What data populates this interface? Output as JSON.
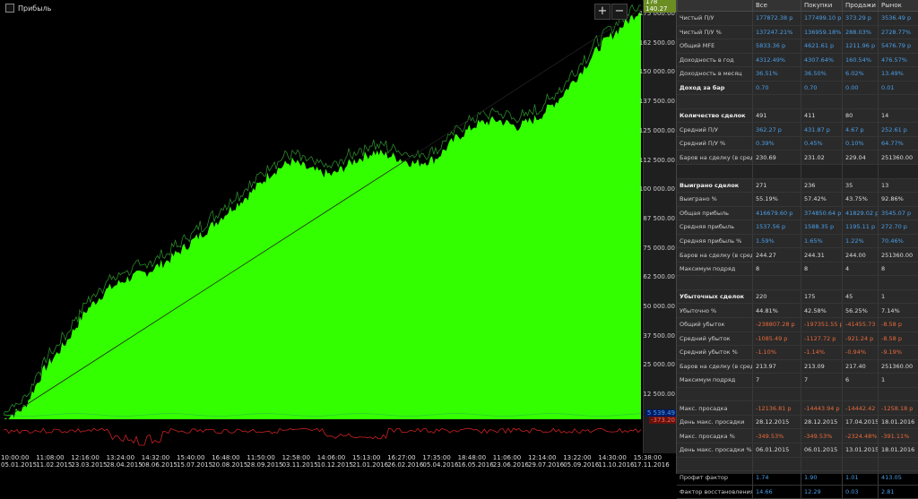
{
  "chart": {
    "title": "Прибыль",
    "zoom_in": "+",
    "zoom_out": "−",
    "y_ticks": [
      "175 000.00",
      "162 500.00",
      "150 000.00",
      "137 500.00",
      "125 000.00",
      "112 500.00",
      "100 000.00",
      "87 500.00",
      "75 000.00",
      "62 500.00",
      "50 000.00",
      "37 500.00",
      "25 000.00",
      "12 500.00"
    ],
    "y_badges": {
      "top": "178 140.27",
      "mid": "5 539.49",
      "bottom": "-373.20"
    },
    "x_ticks": [
      {
        "time": "10:00:00",
        "date": "05.01.2015"
      },
      {
        "time": "11:08:00",
        "date": "11.02.2015"
      },
      {
        "time": "12:16:00",
        "date": "23.03.2015"
      },
      {
        "time": "13:24:00",
        "date": "28.04.2015"
      },
      {
        "time": "14:32:00",
        "date": "08.06.2015"
      },
      {
        "time": "15:40:00",
        "date": "15.07.2015"
      },
      {
        "time": "16:48:00",
        "date": "20.08.2015"
      },
      {
        "time": "11:50:00",
        "date": "28.09.2015"
      },
      {
        "time": "12:58:00",
        "date": "03.11.2015"
      },
      {
        "time": "14:06:00",
        "date": "10.12.2015"
      },
      {
        "time": "15:13:00",
        "date": "21.01.2016"
      },
      {
        "time": "16:27:00",
        "date": "26.02.2016"
      },
      {
        "time": "17:35:00",
        "date": "05.04.2016"
      },
      {
        "time": "18:48:00",
        "date": "16.05.2016"
      },
      {
        "time": "11:06:00",
        "date": "23.06.2016"
      },
      {
        "time": "12:14:00",
        "date": "29.07.2016"
      },
      {
        "time": "13:22:00",
        "date": "05.09.2016"
      },
      {
        "time": "14:30:00",
        "date": "11.10.2016"
      },
      {
        "time": "15:38:00",
        "date": "17.11.2016"
      }
    ],
    "colors": {
      "equity": "#33ff00",
      "drawdown": "#cc2222",
      "baseline": "#33cc33"
    }
  },
  "chart_data": {
    "type": "area",
    "title": "Прибыль",
    "ylim": [
      0,
      178140
    ],
    "series": [
      {
        "name": "Прибыль",
        "values": [
          0,
          5000,
          22000,
          33000,
          47000,
          56000,
          61000,
          64000,
          69000,
          76000,
          83000,
          91000,
          98000,
          107000,
          112000,
          108000,
          106000,
          112000,
          116000,
          114000,
          111000,
          113000,
          122000,
          128000,
          130000,
          127000,
          131000,
          139000,
          150000,
          162000,
          170000,
          178140
        ]
      }
    ]
  },
  "stats": {
    "headers": [
      "",
      "Все",
      "Покупки",
      "Продажи",
      "Рынок"
    ],
    "rows": [
      {
        "label": "Чистый П/У",
        "vals": [
          "177872.38 р",
          "177499.10 р",
          "373.29 р",
          "3536.49 р"
        ],
        "color": "blue"
      },
      {
        "label": "Чистый П/У %",
        "vals": [
          "137247.21%",
          "136959.18%",
          "288.03%",
          "2728.77%"
        ],
        "color": "blue"
      },
      {
        "label": "Общий MFE",
        "vals": [
          "5833.36 р",
          "4621.61 р",
          "1211.96 р",
          "5476.79 р"
        ],
        "color": "blue"
      },
      {
        "label": "Доходность в год",
        "vals": [
          "4312.49%",
          "4307.64%",
          "160.54%",
          "476.57%"
        ],
        "color": "blue"
      },
      {
        "label": "Доходность в месяц",
        "vals": [
          "36.51%",
          "36.50%",
          "6.02%",
          "13.49%"
        ],
        "color": "blue"
      },
      {
        "label": "Доход за бар",
        "vals": [
          "0.70",
          "0.70",
          "0.00",
          "0.01"
        ],
        "color": "blue",
        "bold": true
      },
      {
        "label": "",
        "vals": [
          "",
          "",
          "",
          ""
        ],
        "color": "white"
      },
      {
        "label": "Количество сделок",
        "vals": [
          "491",
          "411",
          "80",
          "14"
        ],
        "color": "white",
        "bold": true
      },
      {
        "label": "Средний П/У",
        "vals": [
          "362.27 р",
          "431.87 р",
          "4.67 р",
          "252.61 р"
        ],
        "color": "blue"
      },
      {
        "label": "Средний П/У %",
        "vals": [
          "0.39%",
          "0.45%",
          "0.10%",
          "64.77%"
        ],
        "color": "blue"
      },
      {
        "label": "Баров на сделку (в среднем)",
        "vals": [
          "230.69",
          "231.02",
          "229.04",
          "251360.00"
        ],
        "color": "white"
      },
      {
        "label": "",
        "vals": [
          "",
          "",
          "",
          ""
        ],
        "color": "white",
        "sep": true
      },
      {
        "label": "Выиграно сделок",
        "vals": [
          "271",
          "236",
          "35",
          "13"
        ],
        "color": "white",
        "bold": true
      },
      {
        "label": "Выиграно %",
        "vals": [
          "55.19%",
          "57.42%",
          "43.75%",
          "92.86%"
        ],
        "color": "white"
      },
      {
        "label": "Общая прибыль",
        "vals": [
          "416679.60 р",
          "374850.64 р",
          "41829.02 р",
          "3545.07 р"
        ],
        "color": "blue"
      },
      {
        "label": "Средняя прибыль",
        "vals": [
          "1537.56 р",
          "1588.35 р",
          "1195.11 р",
          "272.70 р"
        ],
        "color": "blue"
      },
      {
        "label": "Средняя прибыль %",
        "vals": [
          "1.59%",
          "1.65%",
          "1.22%",
          "70.46%"
        ],
        "color": "blue"
      },
      {
        "label": "Баров на сделку (в среднем)",
        "vals": [
          "244.27",
          "244.31",
          "244.00",
          "251360.00"
        ],
        "color": "white"
      },
      {
        "label": "Максимум подряд",
        "vals": [
          "8",
          "8",
          "4",
          "8"
        ],
        "color": "white"
      },
      {
        "label": "",
        "vals": [
          "",
          "",
          "",
          ""
        ],
        "color": "white"
      },
      {
        "label": "Убыточных сделок",
        "vals": [
          "220",
          "175",
          "45",
          "1"
        ],
        "color": "white",
        "bold": true
      },
      {
        "label": "Убыточно %",
        "vals": [
          "44.81%",
          "42.58%",
          "56.25%",
          "7.14%"
        ],
        "color": "white"
      },
      {
        "label": "Общий убыток",
        "vals": [
          "-238807.28 р",
          "-197351.55 р",
          "-41455.73 р",
          "-8.58 р"
        ],
        "color": "red"
      },
      {
        "label": "Средний убыток",
        "vals": [
          "-1085.49 р",
          "-1127.72 р",
          "-921.24 р",
          "-8.58 р"
        ],
        "color": "red"
      },
      {
        "label": "Средний убыток %",
        "vals": [
          "-1.10%",
          "-1.14%",
          "-0.94%",
          "-9.19%"
        ],
        "color": "red"
      },
      {
        "label": "Баров на сделку (в среднем)",
        "vals": [
          "213.97",
          "213.09",
          "217.40",
          "251360.00"
        ],
        "color": "white"
      },
      {
        "label": "Максимум подряд",
        "vals": [
          "7",
          "7",
          "6",
          "1"
        ],
        "color": "white"
      },
      {
        "label": "",
        "vals": [
          "",
          "",
          "",
          ""
        ],
        "color": "white"
      },
      {
        "label": "Макс. просадка",
        "vals": [
          "-12136.81 р",
          "-14443.94 р",
          "-14442.42 р",
          "-1258.18 р"
        ],
        "color": "red"
      },
      {
        "label": "День макс. просадки",
        "vals": [
          "28.12.2015",
          "28.12.2015",
          "17.04.2015",
          "18.01.2016"
        ],
        "color": "white"
      },
      {
        "label": "Макс. просадка %",
        "vals": [
          "-349.53%",
          "-349.53%",
          "-2324.48%",
          "-391.11%"
        ],
        "color": "red"
      },
      {
        "label": "День макс. просадки %",
        "vals": [
          "06.01.2015",
          "06.01.2015",
          "13.01.2015",
          "18.01.2016"
        ],
        "color": "white"
      },
      {
        "label": "",
        "vals": [
          "",
          "",
          "",
          ""
        ],
        "color": "white"
      },
      {
        "label": "Профит фактор",
        "vals": [
          "1.74",
          "1.90",
          "1.01",
          "413.05"
        ],
        "color": "blue"
      },
      {
        "label": "Фактор восстановления",
        "vals": [
          "14.66",
          "12.29",
          "0.03",
          "2.81"
        ],
        "color": "blue"
      }
    ]
  }
}
